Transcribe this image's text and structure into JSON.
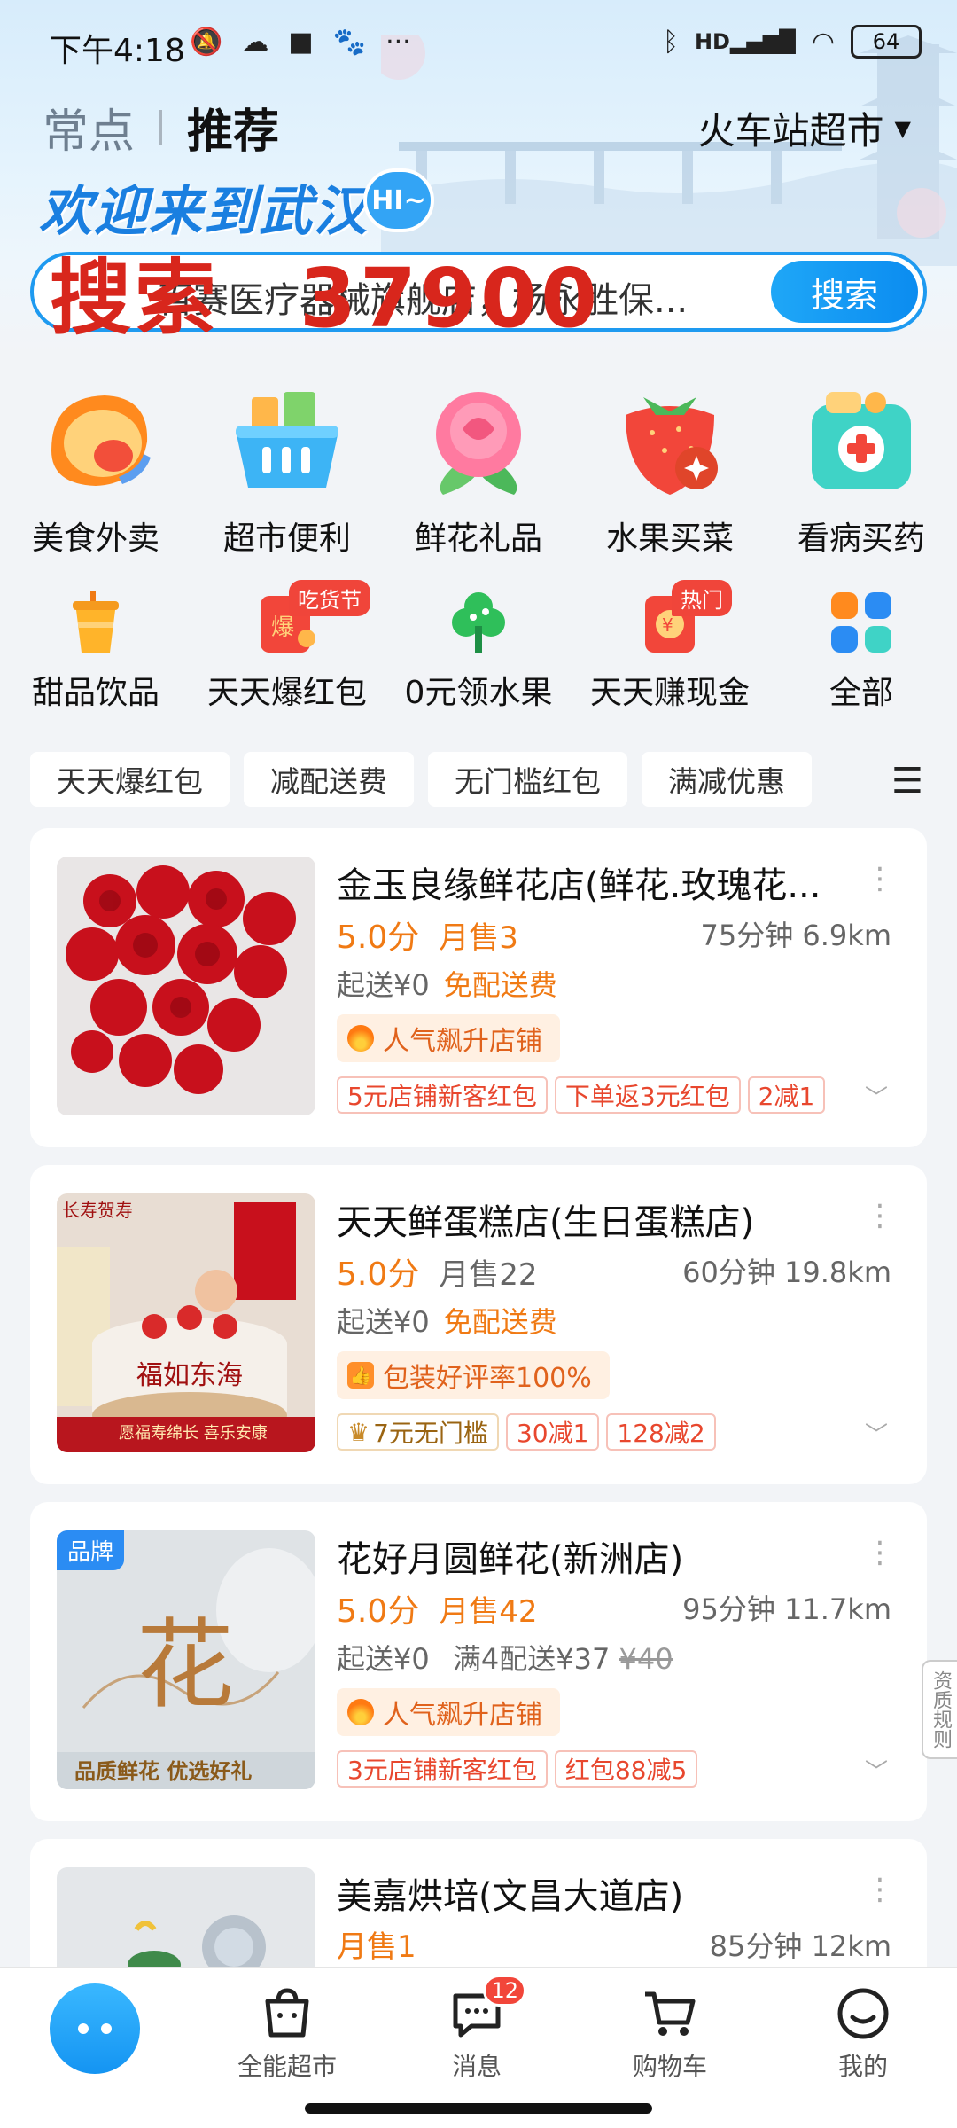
{
  "status_bar": {
    "time": "下午4:18",
    "battery": "64",
    "hd_label": "HD"
  },
  "header": {
    "tabs": [
      "常点",
      "推荐"
    ],
    "location": "火车站超市",
    "welcome": "欢迎来到武汉",
    "hi": "HI~",
    "search_placeholder": "百赛医疗器械旗舰店，杨永胜保...",
    "search_button": "搜索",
    "overlay_word": "搜索",
    "overlay_number": "37900"
  },
  "categories_primary": [
    {
      "label": "美食外卖",
      "icon": "food-delivery-icon"
    },
    {
      "label": "超市便利",
      "icon": "shopping-basket-icon"
    },
    {
      "label": "鲜花礼品",
      "icon": "rose-icon"
    },
    {
      "label": "水果买菜",
      "icon": "strawberry-icon"
    },
    {
      "label": "看病买药",
      "icon": "medicine-box-icon"
    }
  ],
  "categories_secondary": [
    {
      "label": "甜品饮品",
      "icon": "drink-cup-icon",
      "tag": ""
    },
    {
      "label": "天天爆红包",
      "icon": "red-packet-icon",
      "tag": "吃货节"
    },
    {
      "label": "0元领水果",
      "icon": "tree-icon",
      "tag": ""
    },
    {
      "label": "天天赚现金",
      "icon": "cash-envelope-icon",
      "tag": "热门"
    },
    {
      "label": "全部",
      "icon": "grid-icon",
      "tag": ""
    }
  ],
  "filters": [
    "天天爆红包",
    "减配送费",
    "无门槛红包",
    "满减优惠"
  ],
  "stores": [
    {
      "name": "金玉良缘鲜花店(鲜花.玫瑰花...",
      "score": "5.0分",
      "sales": "月售3",
      "eta": "75分钟 6.9km",
      "min_order": "起送¥0",
      "delivery": "免配送费",
      "delivery_old": "",
      "badge": "人气飙升店铺",
      "promos": [
        "5元店铺新客红包",
        "下单返3元红包",
        "2减1"
      ],
      "brand": ""
    },
    {
      "name": "天天鲜蛋糕店(生日蛋糕店)",
      "score": "5.0分",
      "sales": "月售22",
      "eta": "60分钟 19.8km",
      "min_order": "起送¥0",
      "delivery": "免配送费",
      "delivery_old": "",
      "badge": "包装好评率100%",
      "promos": [
        "7元无门槛",
        "30减1",
        "128减2"
      ],
      "brand": "",
      "image_texts": [
        "长寿贺寿",
        "愿福寿绵长 喜乐安康",
        "福如东海"
      ]
    },
    {
      "name": "花好月圆鲜花(新洲店)",
      "score": "5.0分",
      "sales": "月售42",
      "eta": "95分钟 11.7km",
      "min_order": "起送¥0",
      "delivery": "满4配送¥37",
      "delivery_old": "¥40",
      "badge": "人气飙升店铺",
      "promos": [
        "3元店铺新客红包",
        "红包88减5"
      ],
      "brand": "品牌",
      "image_texts": [
        "花",
        "品质鲜花 优选好礼"
      ]
    },
    {
      "name": "美嘉烘培(文昌大道店)",
      "score": "",
      "sales": "月售1",
      "eta": "85分钟 12km"
    }
  ],
  "side_handle": "资质规则",
  "bottom_nav": [
    {
      "label": "全能超市",
      "icon": "market-bag-icon",
      "badge": ""
    },
    {
      "label": "消息",
      "icon": "message-icon",
      "badge": "12"
    },
    {
      "label": "购物车",
      "icon": "cart-icon",
      "badge": ""
    },
    {
      "label": "我的",
      "icon": "profile-smile-icon",
      "badge": ""
    }
  ],
  "colors": {
    "accent": "#1E9AF0",
    "orange": "#F07A14",
    "red": "#E8472E"
  }
}
